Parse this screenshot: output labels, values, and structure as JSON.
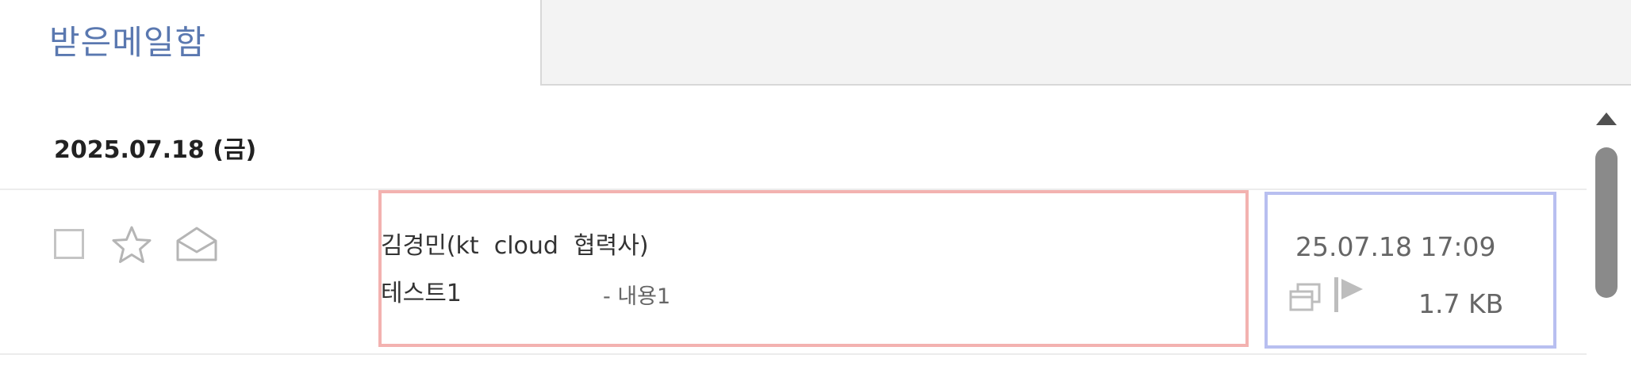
{
  "tabs": {
    "active_label": "받은메일함"
  },
  "date_group": {
    "label": "2025.07.18 (금)"
  },
  "email": {
    "sender": "김경민(kt  cloud  협력사)",
    "subject": "테스트1",
    "preview": "- 내용1",
    "datetime": "25.07.18 17:09",
    "size": "1.7 KB",
    "checked": false,
    "starred": false,
    "read": true
  },
  "colors": {
    "tab_label": "#5a78b0",
    "sender_box_border": "#f3b2b0",
    "meta_box_border": "#b8bff0",
    "scrollbar_thumb": "#8a8a8a"
  },
  "icons": {
    "star": "star-icon",
    "mail": "envelope-open-icon",
    "copy": "copy-icon",
    "flag": "flag-icon",
    "scroll_up": "triangle-up-icon"
  }
}
